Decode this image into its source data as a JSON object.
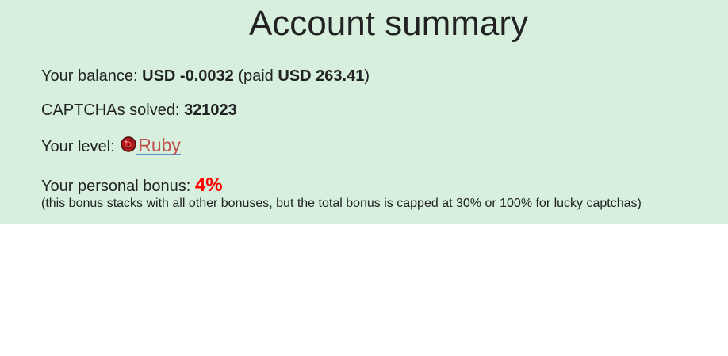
{
  "title": "Account summary",
  "balance": {
    "label": "Your balance: ",
    "amount": "USD -0.0032",
    "paid_prefix": " (paid ",
    "paid_amount": "USD 263.41",
    "paid_suffix": ")"
  },
  "captchas": {
    "label": "CAPTCHAs solved: ",
    "value": "321023"
  },
  "level": {
    "label": "Your level: ",
    "icon": "ruby-gem-icon",
    "name": "Ruby"
  },
  "bonus": {
    "label": "Your personal bonus: ",
    "value": "4%",
    "note": "(this bonus stacks with all other bonuses, but the total bonus is capped at 30% or 100% for lucky captchas)"
  },
  "colors": {
    "panel_background": "#d6f0dd",
    "bonus_value": "#ff0000",
    "level_link": "#c0504d",
    "link_underline": "#5b8fd0"
  }
}
